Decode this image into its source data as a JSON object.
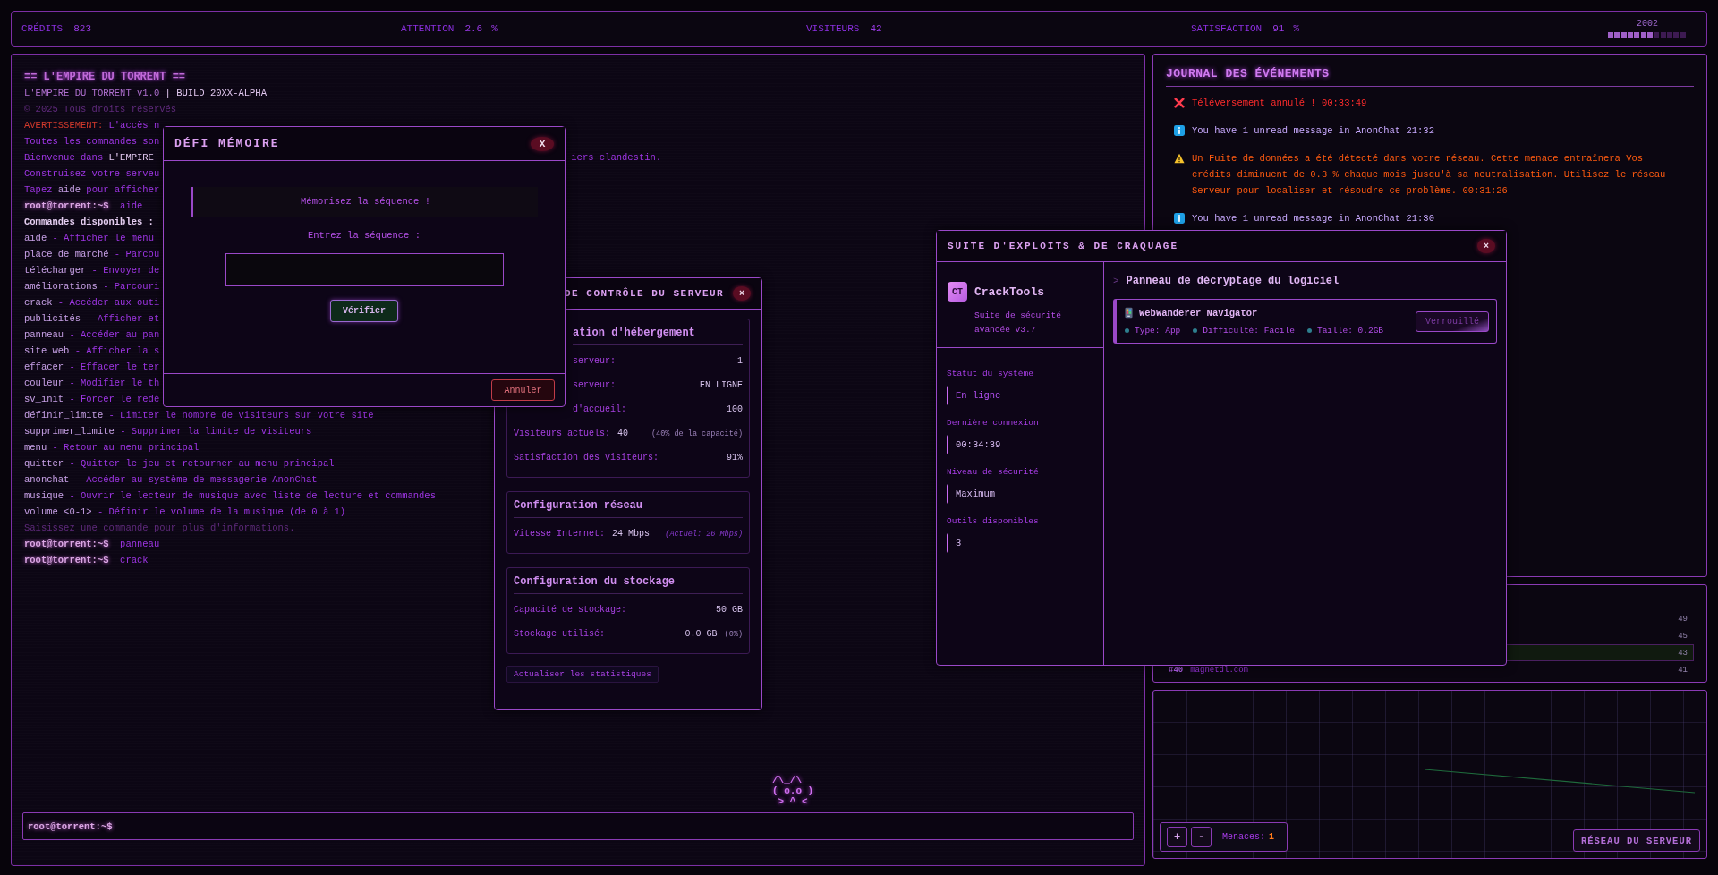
{
  "stats_bar": {
    "items": [
      {
        "label": "CRÉDITS",
        "value": "823"
      },
      {
        "label": "ATTENTION",
        "value": "2.6",
        "unit": "%"
      },
      {
        "label": "VISITEURS",
        "value": "42"
      },
      {
        "label": "SATISFACTION",
        "value": "91",
        "unit": "%"
      }
    ],
    "year": "2002",
    "progress": {
      "level": 0.58
    }
  },
  "terminal": {
    "lines": [
      {
        "parts": [
          {
            "text": "== L'EMPIRE DU TORRENT ==",
            "kind": "title"
          }
        ]
      },
      {
        "parts": [
          {
            "text": "L'EMPIRE DU TORRENT v1.0",
            "kind": "soft"
          },
          {
            "text": "| BUILD 20XX-ALPHA",
            "kind": "bright"
          }
        ]
      },
      {
        "parts": [
          {
            "text": "© 2025 Tous droits réservés",
            "kind": "dim"
          }
        ]
      },
      {
        "parts": [
          {
            "text": "AVERTISSEMENT:",
            "kind": "warn"
          },
          {
            "text": "L'accès n",
            "kind": "text"
          }
        ]
      },
      {
        "parts": [
          {
            "text": "Toutes les commandes son",
            "kind": "text"
          }
        ]
      },
      {
        "parts": [
          {
            "text": "Bienvenue dans",
            "kind": "text"
          },
          {
            "text": "L'EMPIRE",
            "kind": "bright"
          }
        ],
        "tail": "iers clandestin."
      },
      {
        "parts": [
          {
            "text": "Construisez votre serveu",
            "kind": "text"
          }
        ]
      },
      {
        "parts": [
          {
            "text": "Tapez",
            "kind": "text"
          },
          {
            "text": "aide",
            "kind": "cmd"
          },
          {
            "text": "pour afficher",
            "kind": "text"
          }
        ]
      },
      {
        "parts": [
          {
            "text": "root@torrent:~$",
            "kind": "prompt"
          },
          {
            "text": "aide",
            "kind": "text"
          }
        ]
      },
      {
        "parts": [
          {
            "text": "Commandes disponibles :",
            "kind": "bold"
          }
        ]
      },
      {
        "parts": [
          {
            "text": "aide",
            "kind": "cmd"
          },
          {
            "text": "- Afficher le menu",
            "kind": "text"
          }
        ]
      },
      {
        "parts": [
          {
            "text": "place de marché",
            "kind": "cmd"
          },
          {
            "text": "- Parcou",
            "kind": "text"
          }
        ]
      },
      {
        "parts": [
          {
            "text": "télécharger",
            "kind": "cmd"
          },
          {
            "text": "- Envoyer de",
            "kind": "text"
          }
        ]
      },
      {
        "parts": [
          {
            "text": "améliorations",
            "kind": "cmd"
          },
          {
            "text": "- Parcouri",
            "kind": "text"
          }
        ]
      },
      {
        "parts": [
          {
            "text": "crack",
            "kind": "cmd"
          },
          {
            "text": "- Accéder aux outi",
            "kind": "text"
          }
        ]
      },
      {
        "parts": [
          {
            "text": "publicités",
            "kind": "cmd"
          },
          {
            "text": "- Afficher et",
            "kind": "text"
          }
        ]
      },
      {
        "parts": [
          {
            "text": "panneau",
            "kind": "cmd"
          },
          {
            "text": "- Accéder au pan",
            "kind": "text"
          }
        ]
      },
      {
        "parts": [
          {
            "text": "site web",
            "kind": "cmd"
          },
          {
            "text": "- Afficher la s",
            "kind": "text"
          }
        ]
      },
      {
        "parts": [
          {
            "text": "effacer",
            "kind": "cmd"
          },
          {
            "text": "- Effacer le ter",
            "kind": "text"
          }
        ]
      },
      {
        "parts": [
          {
            "text": "couleur",
            "kind": "cmd"
          },
          {
            "text": "- Modifier le th",
            "kind": "text"
          }
        ]
      },
      {
        "parts": [
          {
            "text": "sv_init",
            "kind": "cmd"
          },
          {
            "text": "- Forcer le redé",
            "kind": "text"
          }
        ]
      },
      {
        "parts": [
          {
            "text": "définir_limite",
            "kind": "cmd"
          },
          {
            "text": "- Limiter le nombre de visiteurs sur votre site",
            "kind": "text"
          }
        ]
      },
      {
        "parts": [
          {
            "text": "supprimer_limite",
            "kind": "cmd"
          },
          {
            "text": "- Supprimer la limite de visiteurs",
            "kind": "text"
          }
        ]
      },
      {
        "parts": [
          {
            "text": "menu",
            "kind": "cmd"
          },
          {
            "text": "- Retour au menu principal",
            "kind": "text"
          }
        ]
      },
      {
        "parts": [
          {
            "text": "quitter",
            "kind": "cmd"
          },
          {
            "text": "- Quitter le jeu et retourner au menu principal",
            "kind": "text"
          }
        ]
      },
      {
        "parts": [
          {
            "text": "anonchat",
            "kind": "cmd"
          },
          {
            "text": "- Accéder au système de messagerie AnonChat",
            "kind": "text"
          }
        ]
      },
      {
        "parts": [
          {
            "text": "musique",
            "kind": "cmd"
          },
          {
            "text": "- Ouvrir le lecteur de musique avec liste de lecture et commandes",
            "kind": "text"
          }
        ]
      },
      {
        "parts": [
          {
            "text": "volume <0-1>",
            "kind": "cmd"
          },
          {
            "text": "- Définir le volume de la musique (de 0 à 1)",
            "kind": "text"
          }
        ]
      },
      {
        "parts": [
          {
            "text": "Saisissez une commande pour plus d'informations.",
            "kind": "dim"
          }
        ]
      },
      {
        "parts": [
          {
            "text": "root@torrent:~$",
            "kind": "prompt"
          },
          {
            "text": "panneau",
            "kind": "text"
          }
        ]
      },
      {
        "parts": [
          {
            "text": "root@torrent:~$",
            "kind": "prompt"
          },
          {
            "text": "crack",
            "kind": "text"
          }
        ]
      }
    ],
    "input_prompt": "root@torrent:~$"
  },
  "mascot": {
    "lines": [
      "/\\_/\\",
      "( o.o )",
      " > ^ <"
    ]
  },
  "memory_dialog": {
    "title": "DÉFI MÉMOIRE",
    "close": "X",
    "message": "Mémorisez la séquence !",
    "prompt": "Entrez la séquence :",
    "verify": "Vérifier",
    "cancel": "Annuler"
  },
  "server_panel": {
    "title": "DE CONTRÔLE DU SERVEUR",
    "close": "×",
    "sections": [
      {
        "heading": "ation d'hébergement",
        "rows": [
          {
            "kind": "stat",
            "label": "serveur:",
            "value": "1"
          },
          {
            "kind": "stat",
            "label": "serveur:",
            "value": "EN LIGNE"
          },
          {
            "kind": "stat",
            "label": "d'accueil:",
            "value": "100"
          },
          {
            "kind": "inline",
            "label": "Visiteurs actuels:",
            "value": "40",
            "note": "(40% de la capacité)"
          },
          {
            "kind": "stat",
            "label": "Satisfaction des visiteurs:",
            "value": "91%"
          }
        ]
      },
      {
        "heading": "Configuration réseau",
        "rows": [
          {
            "kind": "estimate",
            "label": "Vitesse Internet:",
            "value": "24 Mbps",
            "note": "(Actuel: 26 Mbps)"
          }
        ]
      },
      {
        "heading": "Configuration du stockage",
        "rows": [
          {
            "kind": "stat",
            "label": "Capacité de stockage:",
            "value": "50 GB"
          },
          {
            "kind": "stat",
            "label": "Stockage utilisé:",
            "value": "0.0 GB",
            "note": "(0%)"
          }
        ]
      }
    ],
    "refresh": "Actualiser les statistiques"
  },
  "journal": {
    "title": "JOURNAL DES ÉVÉNEMENTS",
    "events": [
      {
        "kind": "error",
        "text": "Téléversement annulé ! 00:33:49"
      },
      {
        "kind": "info",
        "text": "You have 1 unread message in AnonChat 21:32"
      },
      {
        "kind": "warning",
        "text": "Un Fuite de données a été détecté dans votre réseau. Cette menace entraînera Vos crédits diminuent de 0.3 % chaque mois jusqu'à sa neutralisation. Utilisez le réseau Serveur pour localiser et résoudre ce problème. 00:31:26"
      },
      {
        "kind": "info",
        "text": "You have 1 unread message in AnonChat 21:30"
      }
    ]
  },
  "leaderboard": {
    "rows": [
      {
        "score": "49",
        "selected": false
      },
      {
        "score": "45",
        "selected": false
      },
      {
        "score": "43",
        "selected": true
      },
      {
        "rank": "#40",
        "site": "magnetdl.com",
        "score": "41",
        "selected": false
      }
    ]
  },
  "exploit_suite": {
    "title": "SUITE D'EXPLOITS & DE CRAQUAGE",
    "close": "×",
    "logo": "CT",
    "name": "CrackTools",
    "subtitle": "Suite de sécurité avancée v3.7",
    "stats": [
      {
        "label": "Statut du système",
        "value": "En ligne"
      },
      {
        "label": "Dernière connexion",
        "value": "00:34:39"
      },
      {
        "label": "Niveau de sécurité",
        "value": "Maximum"
      },
      {
        "label": "Outils disponibles",
        "value": "3"
      }
    ],
    "heading_marker": ">",
    "heading": "Panneau de décryptage du logiciel",
    "tools": [
      {
        "name": "WebWanderer Navigator",
        "meta": [
          "Type: App",
          "Difficulté: Facile",
          "Taille: 0.2GB"
        ],
        "action": "Verrouillé",
        "locked": true
      }
    ]
  },
  "network": {
    "zoom_in": "+",
    "zoom_out": "-",
    "threats_label": "Menaces:",
    "threats": "1",
    "title": "RÉSEAU DU SERVEUR"
  }
}
